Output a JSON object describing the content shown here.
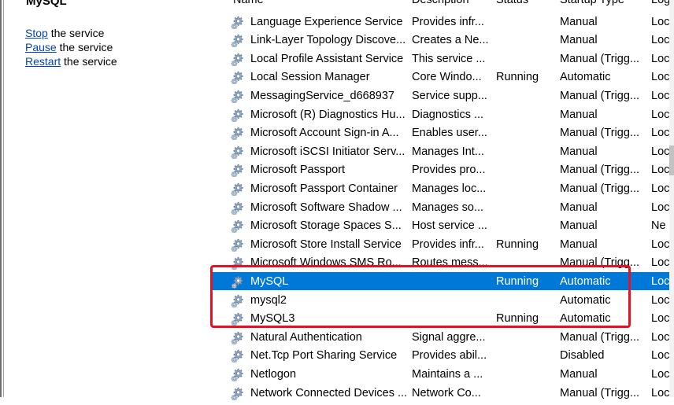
{
  "left_pane": {
    "service_title": "MySQL",
    "actions": [
      {
        "link": "Stop",
        "rest": " the service"
      },
      {
        "link": "Pause",
        "rest": " the service"
      },
      {
        "link": "Restart",
        "rest": " the service"
      }
    ]
  },
  "columns": {
    "name": "Name",
    "description": "Description",
    "status": "Status",
    "startup_type": "Startup Type",
    "logon_as": "Log"
  },
  "services": [
    {
      "name": "Language Experience Service",
      "description": "Provides infr...",
      "status": "",
      "startup": "Manual",
      "logon": "Loc"
    },
    {
      "name": "Link-Layer Topology Discove...",
      "description": "Creates a Ne...",
      "status": "",
      "startup": "Manual",
      "logon": "Loc"
    },
    {
      "name": "Local Profile Assistant Service",
      "description": "This service ...",
      "status": "",
      "startup": "Manual (Trigg...",
      "logon": "Loc"
    },
    {
      "name": "Local Session Manager",
      "description": "Core Windo...",
      "status": "Running",
      "startup": "Automatic",
      "logon": "Loc"
    },
    {
      "name": "MessagingService_d668937",
      "description": "Service supp...",
      "status": "",
      "startup": "Manual (Trigg...",
      "logon": "Loc"
    },
    {
      "name": "Microsoft (R) Diagnostics Hu...",
      "description": "Diagnostics ...",
      "status": "",
      "startup": "Manual",
      "logon": "Loc"
    },
    {
      "name": "Microsoft Account Sign-in A...",
      "description": "Enables user...",
      "status": "",
      "startup": "Manual (Trigg...",
      "logon": "Loc"
    },
    {
      "name": "Microsoft iSCSI Initiator Serv...",
      "description": "Manages Int...",
      "status": "",
      "startup": "Manual",
      "logon": "Loc"
    },
    {
      "name": "Microsoft Passport",
      "description": "Provides pro...",
      "status": "",
      "startup": "Manual (Trigg...",
      "logon": "Loc"
    },
    {
      "name": "Microsoft Passport Container",
      "description": "Manages loc...",
      "status": "",
      "startup": "Manual (Trigg...",
      "logon": "Loc"
    },
    {
      "name": "Microsoft Software Shadow ...",
      "description": "Manages so...",
      "status": "",
      "startup": "Manual",
      "logon": "Loc"
    },
    {
      "name": "Microsoft Storage Spaces S...",
      "description": "Host service ...",
      "status": "",
      "startup": "Manual",
      "logon": "Ne"
    },
    {
      "name": "Microsoft Store Install Service",
      "description": "Provides infr...",
      "status": "Running",
      "startup": "Manual",
      "logon": "Loc"
    },
    {
      "name": "Microsoft Windows SMS Ro...",
      "description": "Routes mess...",
      "status": "",
      "startup": "Manual (Trigg...",
      "logon": "Loc"
    },
    {
      "name": "MySQL",
      "description": "",
      "status": "Running",
      "startup": "Automatic",
      "logon": "Loc",
      "selected": true
    },
    {
      "name": "mysql2",
      "description": "",
      "status": "",
      "startup": "Automatic",
      "logon": "Loc"
    },
    {
      "name": "MySQL3",
      "description": "",
      "status": "Running",
      "startup": "Automatic",
      "logon": "Loc"
    },
    {
      "name": "Natural Authentication",
      "description": "Signal aggre...",
      "status": "",
      "startup": "Manual (Trigg...",
      "logon": "Loc"
    },
    {
      "name": "Net.Tcp Port Sharing Service",
      "description": "Provides abil...",
      "status": "",
      "startup": "Disabled",
      "logon": "Loc"
    },
    {
      "name": "Netlogon",
      "description": "Maintains a ...",
      "status": "",
      "startup": "Manual",
      "logon": "Loc"
    },
    {
      "name": "Network Connected Devices ...",
      "description": "Network Co...",
      "status": "",
      "startup": "Manual (Trigg...",
      "logon": "Loc"
    }
  ],
  "icons": {
    "service": "gear-icon"
  },
  "colors": {
    "selection": "#0078d7",
    "highlight": "#e81123",
    "link": "#0645ad"
  }
}
